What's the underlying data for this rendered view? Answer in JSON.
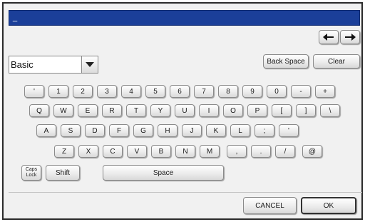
{
  "input": {
    "value": "_"
  },
  "nav": {
    "left_icon": "arrow-left",
    "right_icon": "arrow-right"
  },
  "mode_select": {
    "value": "Basic"
  },
  "actions": {
    "backspace": "Back Space",
    "clear": "Clear"
  },
  "rows": {
    "r1": [
      "'",
      "1",
      "2",
      "3",
      "4",
      "5",
      "6",
      "7",
      "8",
      "9",
      "0",
      "-",
      "+"
    ],
    "r2": [
      "Q",
      "W",
      "E",
      "R",
      "T",
      "Y",
      "U",
      "I",
      "O",
      "P",
      "[",
      "]",
      "\\"
    ],
    "r3": [
      "A",
      "S",
      "D",
      "F",
      "G",
      "H",
      "J",
      "K",
      "L",
      ";",
      "'"
    ],
    "r4": [
      "Z",
      "X",
      "C",
      "V",
      "B",
      "N",
      "M",
      ",",
      ".",
      "/",
      "@"
    ]
  },
  "modifiers": {
    "caps_top": "Caps",
    "caps_bottom": "Lock",
    "shift": "Shift",
    "space": "Space"
  },
  "footer": {
    "cancel": "CANCEL",
    "ok": "OK"
  },
  "colors": {
    "input_bar": "#1b3f99",
    "panel": "#f1f1f1"
  }
}
